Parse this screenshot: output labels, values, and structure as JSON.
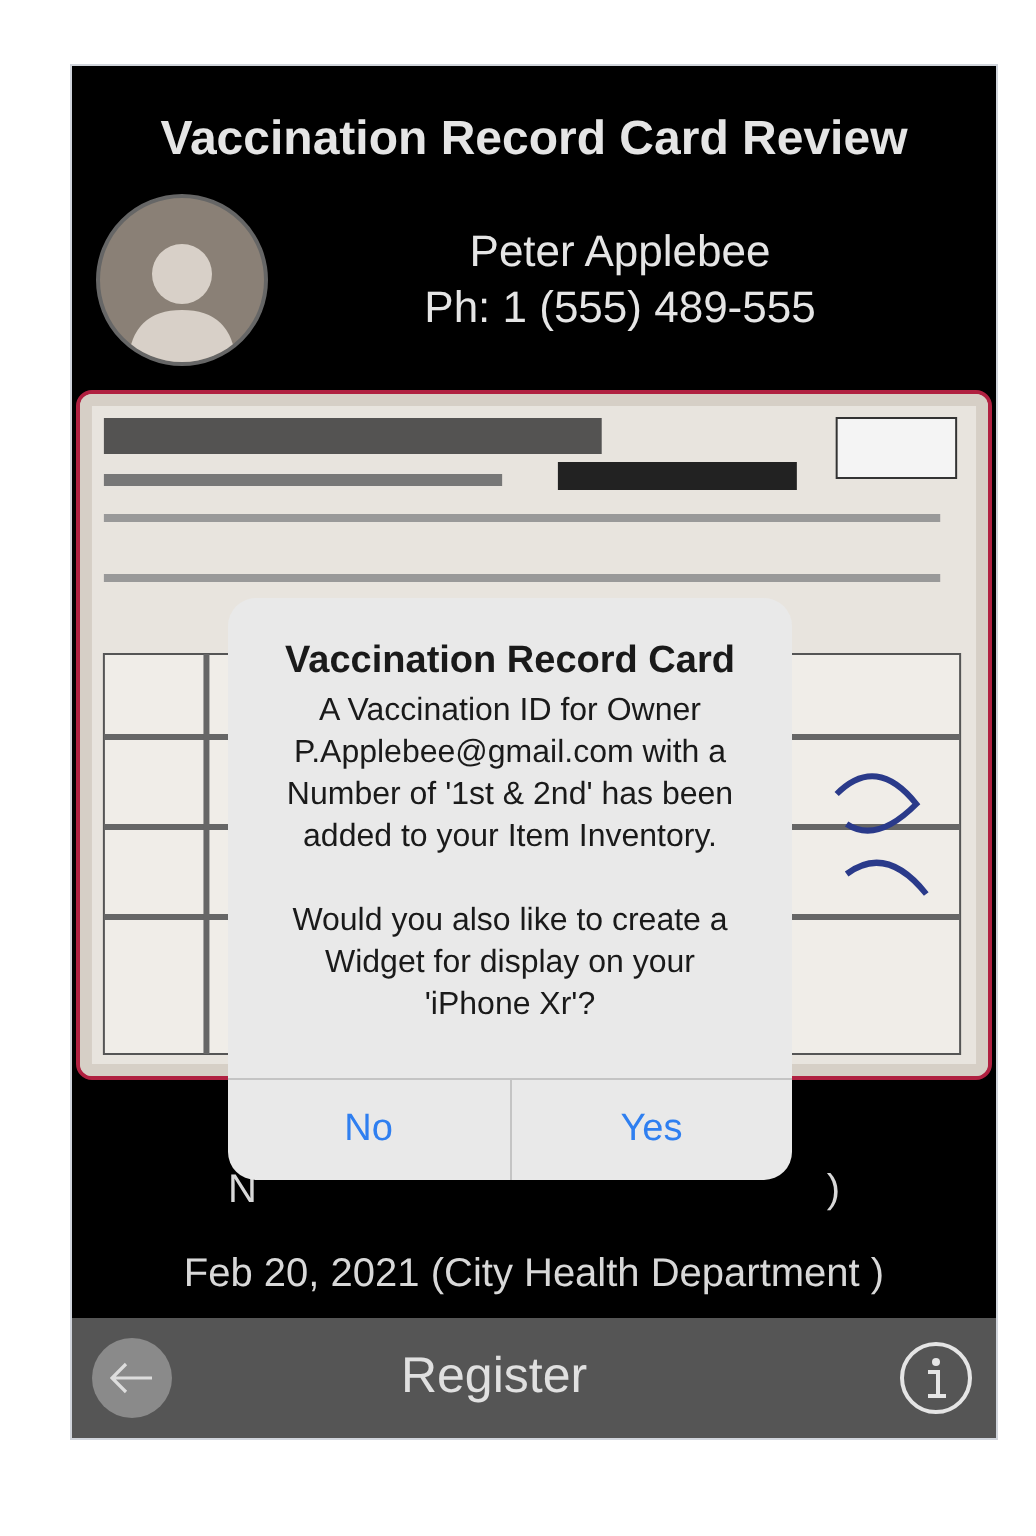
{
  "header": {
    "title": "Vaccination Record Card Review",
    "name": "Peter Applebee",
    "phone": "Ph: 1 (555) 489-555"
  },
  "details": {
    "line_1_left": "N",
    "line_1_right": ")",
    "line_2": "Feb 20, 2021 (City Health Department )"
  },
  "alert": {
    "title": "Vaccination Record Card",
    "message": "A Vaccination ID for Owner P.Applebee@gmail.com with a Number of '1st & 2nd' has been added to your Item Inventory.",
    "question": "Would you also like to create a Widget for display on your 'iPhone Xr'?",
    "buttons": [
      "No",
      "Yes"
    ]
  },
  "bottom_bar": {
    "title": "Register"
  }
}
